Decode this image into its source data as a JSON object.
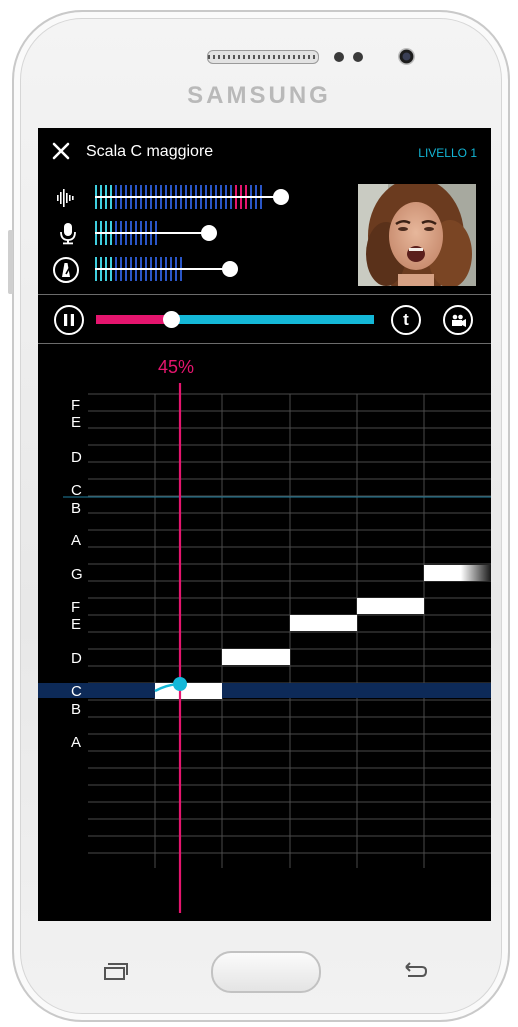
{
  "device": {
    "brand": "SAMSUNG"
  },
  "header": {
    "title": "Scala C maggiore",
    "level_label": "LIVELLO 1"
  },
  "meters": [
    {
      "name": "volume",
      "icon": "waveform-icon",
      "level": 0.89
    },
    {
      "name": "microphone",
      "icon": "microphone-icon",
      "level": 0.55
    },
    {
      "name": "metronome",
      "icon": "metronome-icon",
      "level": 0.64
    }
  ],
  "playback": {
    "state": "paused-button-shown",
    "progress": 0.27,
    "t_label": "t"
  },
  "exercise": {
    "percent_label": "45%",
    "notes_top": [
      "F",
      "E",
      "D",
      "C",
      "B",
      "A",
      "G",
      "F",
      "E",
      "D",
      "C",
      "B",
      "A"
    ],
    "target_notes": [
      "C",
      "D",
      "E",
      "F",
      "G"
    ]
  },
  "colors": {
    "accent_blue": "#14b8d8",
    "accent_pink": "#e5156e",
    "active_row": "#0d2a58",
    "screen_bg": "#000000"
  }
}
